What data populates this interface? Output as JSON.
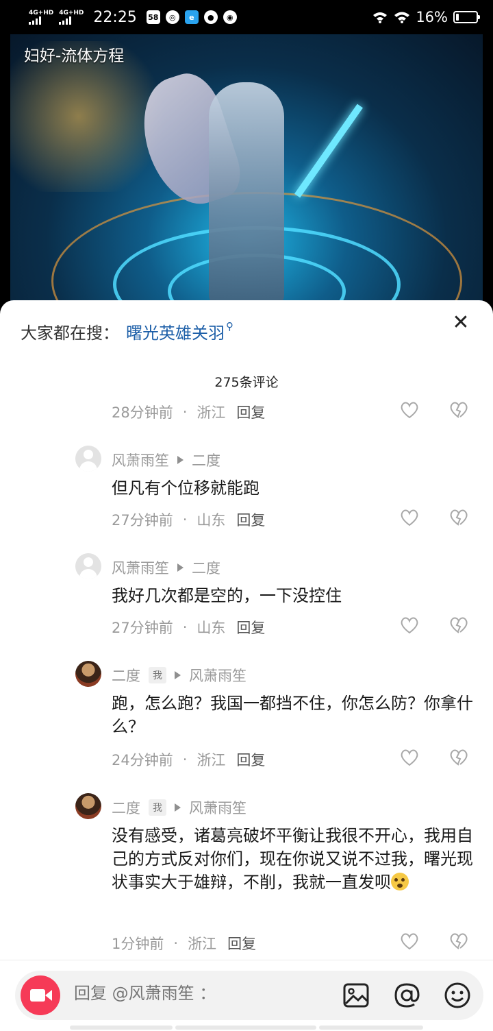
{
  "status_bar": {
    "signal1": "4G+HD",
    "signal2": "4G+HD",
    "time": "22:25",
    "app_badge": "58",
    "battery": "16%",
    "battery_level": 0.16
  },
  "video": {
    "title": "妇好-流体方程"
  },
  "sheet": {
    "search_prefix": "大家都在搜：",
    "search_term": "曙光英雄关羽",
    "close_icon": "close-icon",
    "comment_count": "275条评论"
  },
  "top_meta": {
    "time": "28分钟前",
    "location": "浙江",
    "reply": "回复"
  },
  "comments": [
    {
      "author": "风萧雨笙",
      "reply_to": "二度",
      "is_me": false,
      "text": "但凡有个位移就能跑",
      "time": "27分钟前",
      "location": "山东",
      "reply": "回复"
    },
    {
      "author": "风萧雨笙",
      "reply_to": "二度",
      "is_me": false,
      "text": "我好几次都是空的，一下没控住",
      "time": "27分钟前",
      "location": "山东",
      "reply": "回复"
    },
    {
      "author": "二度",
      "me_tag": "我",
      "reply_to": "风萧雨笙",
      "is_me": true,
      "text": "跑，怎么跑？我国一都挡不住，你怎么防？你拿什么？",
      "time": "24分钟前",
      "location": "浙江",
      "reply": "回复"
    },
    {
      "author": "二度",
      "me_tag": "我",
      "reply_to": "风萧雨笙",
      "is_me": true,
      "text": "没有感受，诸葛亮破坏平衡让我很不开心，我用自己的方式反对你们，现在你说又说不过我，曙光现状事实大于雄辩，不削，我就一直发呗",
      "time": "1分钟前",
      "location": "浙江",
      "reply": "回复"
    }
  ],
  "composer": {
    "placeholder": "回复 @风萧雨笙 ：",
    "icons": [
      "video-camera-icon",
      "image-icon",
      "at-icon",
      "emoji-icon"
    ]
  },
  "colors": {
    "accent": "#f63a57",
    "link": "#1d5fa8"
  }
}
